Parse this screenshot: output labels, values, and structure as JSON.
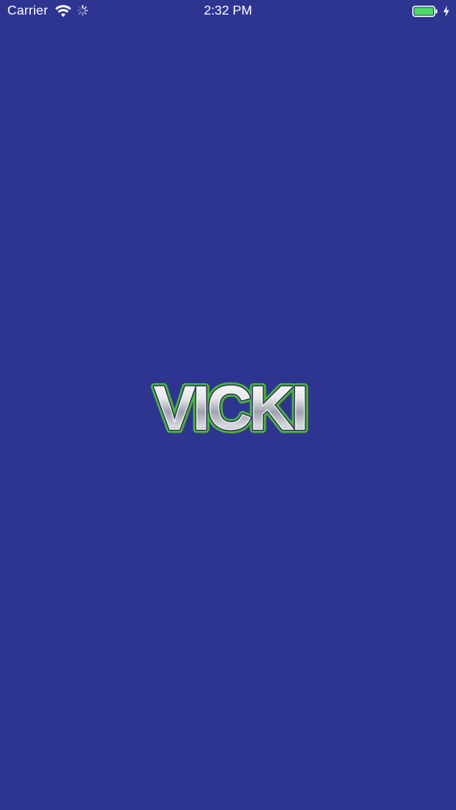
{
  "status_bar": {
    "carrier": "Carrier",
    "time": "2:32 PM",
    "wifi_icon": "wifi-icon",
    "activity_icon": "activity-spinner-icon",
    "battery_icon": "battery-icon",
    "charging_icon": "charging-bolt-icon",
    "battery_color": "#4cd964"
  },
  "splash": {
    "background_color": "#2e3590",
    "logo_text": "VICKI",
    "logo_outline_color": "#4bb543"
  }
}
